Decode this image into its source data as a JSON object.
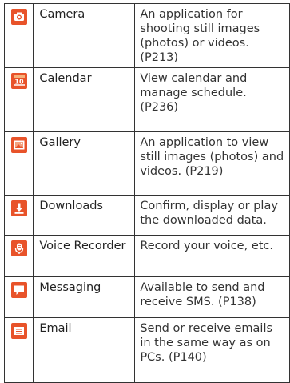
{
  "apps": [
    {
      "name": "Camera",
      "description": "An application for shooting still images (photos) or videos. (P213)",
      "icon": "camera-icon",
      "color": "#e8532a"
    },
    {
      "name": "Calendar",
      "description": "View calendar and manage schedule. (P236)",
      "icon": "calendar-icon",
      "color": "#e8532a",
      "icon_text": "10"
    },
    {
      "name": "Gallery",
      "description": "An application to view still images (photos) and videos. (P219)",
      "icon": "gallery-icon",
      "color": "#e8532a"
    },
    {
      "name": "Downloads",
      "description": "Confirm, display or play the downloaded data.",
      "icon": "download-icon",
      "color": "#e8532a"
    },
    {
      "name": "Voice Recorder",
      "description": "Record your voice, etc.",
      "icon": "microphone-icon",
      "color": "#e8532a"
    },
    {
      "name": "Messaging",
      "description": "Available to send and receive SMS. (P138)",
      "icon": "message-icon",
      "color": "#e8532a"
    },
    {
      "name": "Email",
      "description": "Send or receive emails in the same way as on PCs. (P140)",
      "icon": "email-icon",
      "color": "#e8532a"
    }
  ]
}
